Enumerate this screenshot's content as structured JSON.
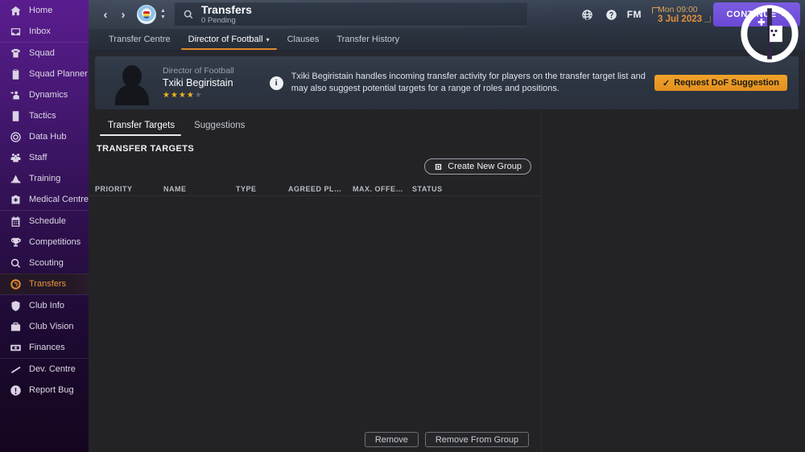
{
  "sidebar": {
    "groups": [
      {
        "items": [
          {
            "label": "Home",
            "icon": "home-icon"
          },
          {
            "label": "Inbox",
            "icon": "inbox-icon"
          }
        ]
      },
      {
        "items": [
          {
            "label": "Squad",
            "icon": "shirt-icon"
          },
          {
            "label": "Squad Planner",
            "icon": "clipboard-icon"
          },
          {
            "label": "Dynamics",
            "icon": "dynamics-icon"
          },
          {
            "label": "Tactics",
            "icon": "tactics-icon"
          },
          {
            "label": "Data Hub",
            "icon": "datahub-icon"
          },
          {
            "label": "Staff",
            "icon": "staff-icon"
          },
          {
            "label": "Training",
            "icon": "training-icon"
          },
          {
            "label": "Medical Centre",
            "icon": "medical-icon"
          }
        ]
      },
      {
        "items": [
          {
            "label": "Schedule",
            "icon": "calendar-icon"
          },
          {
            "label": "Competitions",
            "icon": "trophy-icon"
          },
          {
            "label": "Scouting",
            "icon": "magnifier-icon"
          },
          {
            "label": "Transfers",
            "icon": "transfers-icon",
            "active": true
          }
        ]
      },
      {
        "items": [
          {
            "label": "Club Info",
            "icon": "shield-icon"
          },
          {
            "label": "Club Vision",
            "icon": "briefcase-icon"
          },
          {
            "label": "Finances",
            "icon": "money-icon"
          }
        ]
      },
      {
        "items": [
          {
            "label": "Dev. Centre",
            "icon": "growth-icon"
          },
          {
            "label": "Report Bug",
            "icon": "exclamation-icon"
          }
        ]
      }
    ]
  },
  "topbar": {
    "back_icon": "chevron-left-icon",
    "forward_icon": "chevron-right-icon",
    "club_badge": "manchester-city-badge",
    "search": {
      "icon": "search-icon",
      "title": "Transfers",
      "subtitle": "0 Pending"
    },
    "icons": [
      {
        "name": "globe-icon"
      },
      {
        "name": "help-icon"
      }
    ],
    "fm_logo": "FM",
    "date": {
      "time": "Mon 09:00",
      "day": "3 Jul 2023"
    },
    "continue_label": "CONTINUE",
    "continue_chevron": "»",
    "watermark": "gplus-logo"
  },
  "tabs": [
    {
      "label": "Transfer Centre",
      "active": false,
      "caret": false
    },
    {
      "label": "Director of Football",
      "active": true,
      "caret": true
    },
    {
      "label": "Clauses",
      "active": false,
      "caret": false
    },
    {
      "label": "Transfer History",
      "active": false,
      "caret": false
    }
  ],
  "caret_glyph": "▾",
  "dof": {
    "photo": "player-silhouette",
    "role": "Director of Football",
    "name": "Txiki Begiristain",
    "stars_filled": 4,
    "stars_total": 5,
    "info_icon": "info-icon",
    "info_text": "Txiki Begiristain handles incoming transfer activity for players on the transfer target list and may also suggest potential targets for a range of roles and positions.",
    "request_button": {
      "label": "Request DoF Suggestion",
      "check": "✓",
      "color": "#eda029"
    }
  },
  "main": {
    "sub_tabs": [
      {
        "label": "Transfer Targets",
        "active": true
      },
      {
        "label": "Suggestions",
        "active": false
      }
    ],
    "section_title": "TRANSFER TARGETS",
    "create_group_button": {
      "label": "Create New Group",
      "icon": "add-group-icon"
    },
    "table": {
      "columns": [
        "PRIORITY",
        "NAME",
        "TYPE",
        "AGREED PLAYING...",
        "MAX. OFFER AMO...",
        "STATUS"
      ],
      "rows": []
    },
    "footer_buttons": [
      {
        "label": "Remove"
      },
      {
        "label": "Remove From Group"
      }
    ]
  },
  "colors": {
    "accent_orange": "#e08a2e",
    "continue_purple": "#6a49d6",
    "sidebar_purple": "#5a1c8f",
    "page_bg": "#232326"
  }
}
